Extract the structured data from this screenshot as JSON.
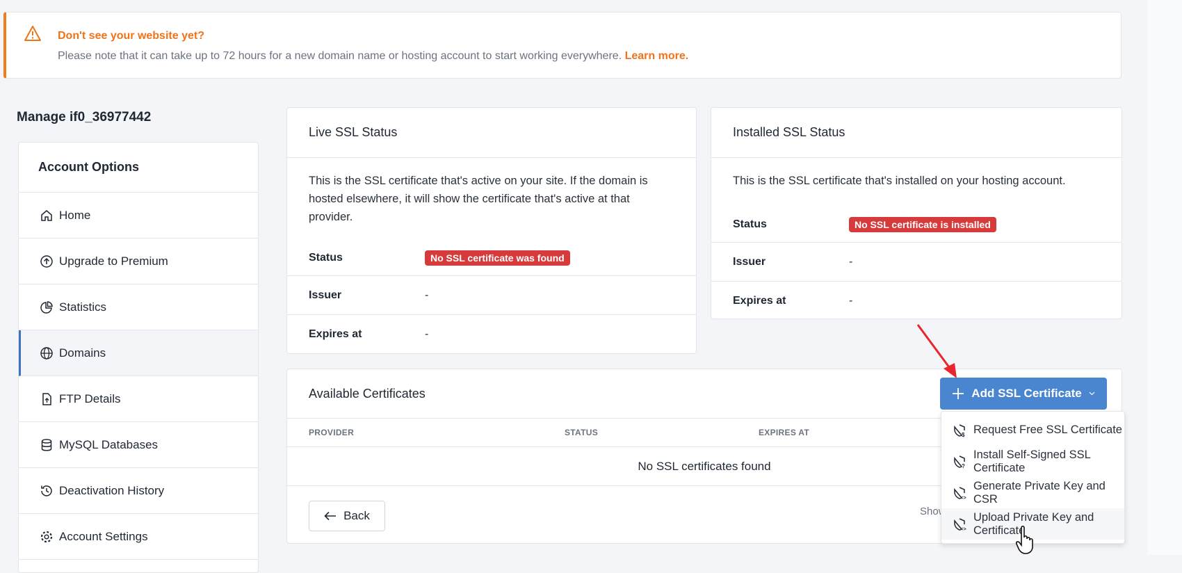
{
  "alert": {
    "title": "Don't see your website yet?",
    "message": "Please note that it can take up to 72 hours for a new domain name or hosting account to start working everywhere.",
    "link": "Learn more.",
    "accent": "#f27c1c"
  },
  "page_title": "Manage if0_36977442",
  "sidebar": {
    "header": "Account Options",
    "items": [
      {
        "label": "Home",
        "icon": "home-icon"
      },
      {
        "label": "Upgrade to Premium",
        "icon": "arrow-up-circle-icon"
      },
      {
        "label": "Statistics",
        "icon": "pie-chart-icon"
      },
      {
        "label": "Domains",
        "icon": "globe-icon",
        "active": true
      },
      {
        "label": "FTP Details",
        "icon": "file-upload-icon"
      },
      {
        "label": "MySQL Databases",
        "icon": "database-icon"
      },
      {
        "label": "Deactivation History",
        "icon": "history-icon"
      },
      {
        "label": "Account Settings",
        "icon": "gear-icon"
      }
    ]
  },
  "live": {
    "title": "Live SSL Status",
    "desc": "This is the SSL certificate that's active on your site. If the domain is hosted elsewhere, it will show the certificate that's active at that provider.",
    "status_label": "Status",
    "status": "No SSL certificate was found",
    "issuer_label": "Issuer",
    "issuer": "-",
    "expires_label": "Expires at",
    "expires": "-"
  },
  "installed": {
    "title": "Installed SSL Status",
    "desc": "This is the SSL certificate that's installed on your hosting account.",
    "status_label": "Status",
    "status": "No SSL certificate is installed",
    "issuer_label": "Issuer",
    "issuer": "-",
    "expires_label": "Expires at",
    "expires": "-"
  },
  "available": {
    "title": "Available Certificates",
    "columns": [
      "PROVIDER",
      "STATUS",
      "EXPIRES AT"
    ],
    "empty": "No SSL certificates found",
    "back": "Back",
    "show": "Show"
  },
  "add_button": {
    "label": "Add SSL Certificate",
    "color": "#4a86d0"
  },
  "dropdown": [
    "Request Free SSL Certificate",
    "Install Self-Signed SSL Certificate",
    "Generate Private Key and CSR",
    "Upload Private Key and Certificate"
  ]
}
